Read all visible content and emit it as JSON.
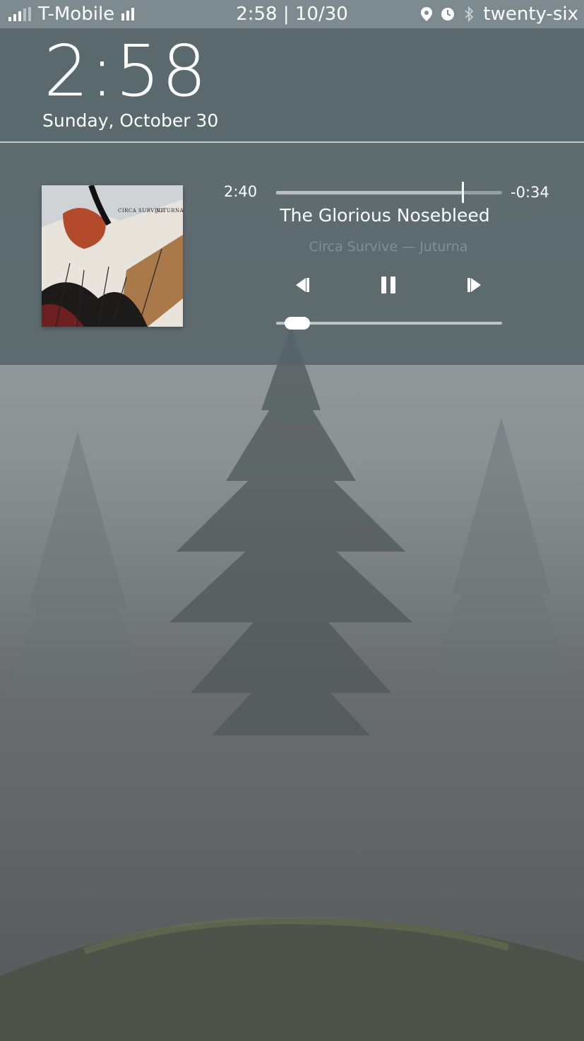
{
  "status_bar": {
    "carrier": "T-Mobile",
    "time_date": "2:58 | 10/30",
    "device_name": "twenty-six",
    "icons": [
      "signal-strength-icon",
      "data-signal-icon",
      "location-icon",
      "alarm-icon",
      "bluetooth-icon"
    ]
  },
  "lockscreen": {
    "time": "2:58",
    "date": "Sunday, October 30"
  },
  "media": {
    "album_art_text": [
      "CIRCA SURVIVE",
      "JUTURNA"
    ],
    "elapsed": "2:40",
    "remaining": "-0:34",
    "progress_fraction": 0.825,
    "title": "The Glorious Nosebleed",
    "subtitle": "Circa Survive — Juturna",
    "controls": [
      "previous-icon",
      "pause-icon",
      "next-icon"
    ],
    "volume_fraction": 0.05
  },
  "colors": {
    "status_bar": "#7d8b91",
    "panel": "#55646a",
    "wallpaper_fog": "#9aa3a5"
  }
}
